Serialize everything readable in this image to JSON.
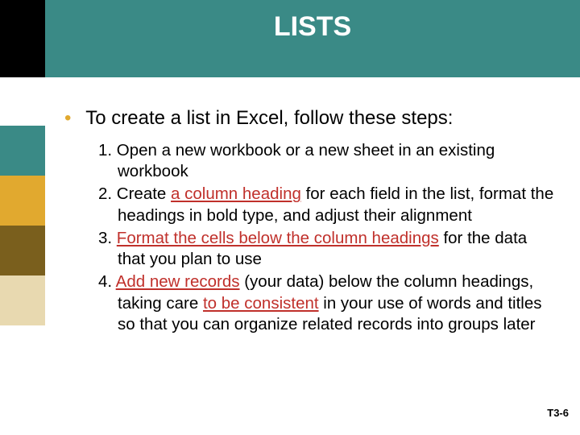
{
  "title": "LISTS",
  "lead_text": "To create a list in Excel, follow these steps:",
  "steps": {
    "s1": "1. Open a new workbook or a new sheet in an existing workbook",
    "s2a": "2. Create ",
    "s2b": "a column heading",
    "s2c": " for each field in the list, format the headings in bold type, and adjust their alignment",
    "s3a": "3. ",
    "s3b": "Format the cells below the column headings",
    "s3c": " for the data that you plan to use",
    "s4a": "4. ",
    "s4b": "Add new records",
    "s4c": " (your data) below the column headings, taking care ",
    "s4d": "to be consistent",
    "s4e": " in your use of words and titles so that you can organize related records into groups later"
  },
  "footer": "T3-6"
}
